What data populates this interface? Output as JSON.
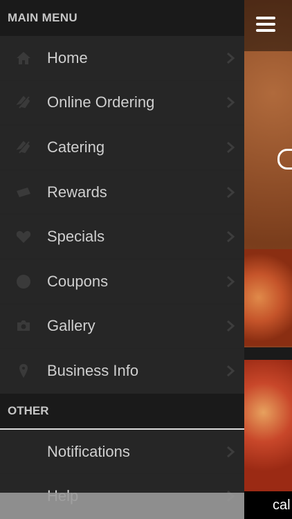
{
  "menu": {
    "header": "MAIN MENU",
    "items": [
      {
        "label": "Home",
        "icon": "home-icon"
      },
      {
        "label": "Online Ordering",
        "icon": "order-icon"
      },
      {
        "label": "Catering",
        "icon": "catering-icon"
      },
      {
        "label": "Rewards",
        "icon": "ticket-icon"
      },
      {
        "label": "Specials",
        "icon": "heart-icon"
      },
      {
        "label": "Coupons",
        "icon": "coupon-icon"
      },
      {
        "label": "Gallery",
        "icon": "camera-icon"
      },
      {
        "label": "Business Info",
        "icon": "map-pin-icon"
      }
    ]
  },
  "other": {
    "header": "OTHER",
    "items": [
      {
        "label": "Notifications"
      },
      {
        "label": "Help"
      }
    ]
  },
  "content": {
    "call_label": "cal"
  },
  "colors": {
    "drawer_bg": "#262626",
    "header_bg": "#1a1a1a",
    "text": "#cfcfcf"
  }
}
